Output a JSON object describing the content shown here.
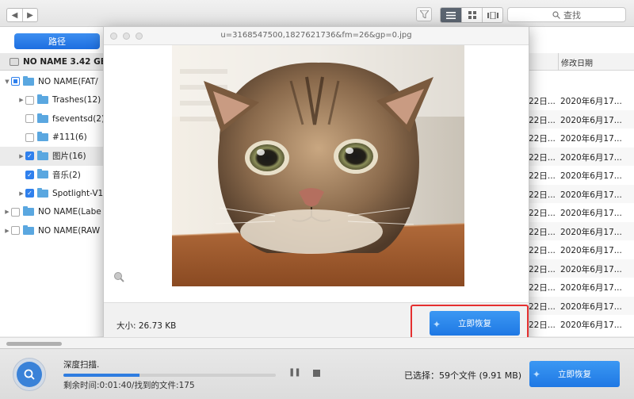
{
  "toolbar": {
    "back_icon": "chevron-left-icon",
    "forward_icon": "chevron-right-icon",
    "search_placeholder": "查找"
  },
  "left_panel": {
    "path_tab": "路径",
    "volume": "NO NAME 3.42 GB",
    "tree": [
      {
        "label": "NO NAME(FAT/",
        "state": "mixed",
        "expanded": true
      },
      {
        "label": "Trashes(12)",
        "state": "unchecked",
        "expanded": false
      },
      {
        "label": "fseventsd(2)",
        "state": "unchecked",
        "expanded": null
      },
      {
        "label": "#111(6)",
        "state": "unchecked",
        "expanded": null
      },
      {
        "label": "图片(16)",
        "state": "checked",
        "expanded": false
      },
      {
        "label": "音乐(2)",
        "state": "checked",
        "expanded": null
      },
      {
        "label": "Spotlight-V1",
        "state": "checked",
        "expanded": false
      },
      {
        "label": "NO NAME(Labe",
        "state": "unchecked",
        "expanded": false
      },
      {
        "label": "NO NAME(RAW",
        "state": "unchecked",
        "expanded": false
      }
    ]
  },
  "list": {
    "column_modified": "修改日期",
    "rows": [
      {
        "created": "22日...",
        "modified": "2020年6月17..."
      },
      {
        "created": "22日...",
        "modified": "2020年6月17..."
      },
      {
        "created": "22日...",
        "modified": "2020年6月17..."
      },
      {
        "created": "22日...",
        "modified": "2020年6月17..."
      },
      {
        "created": "22日...",
        "modified": "2020年6月17..."
      },
      {
        "created": "22日...",
        "modified": "2020年6月17..."
      },
      {
        "created": "22日...",
        "modified": "2020年6月17..."
      },
      {
        "created": "22日...",
        "modified": "2020年6月17..."
      },
      {
        "created": "22日...",
        "modified": "2020年6月17..."
      },
      {
        "created": "22日...",
        "modified": "2020年6月17..."
      },
      {
        "created": "22日...",
        "modified": "2020年6月17..."
      },
      {
        "created": "22日...",
        "modified": "2020年6月17..."
      },
      {
        "created": "22日...",
        "modified": "2020年6月17..."
      }
    ]
  },
  "preview": {
    "title": "u=3168547500,1827621736&fm=26&gp=0.jpg",
    "size_label": "大小: 26.73 KB",
    "recover_button": "立即恢复",
    "highlight_color": "#e53030"
  },
  "bottom": {
    "scan_label": "深度扫描.",
    "remaining": "剩余时间:0:01:40/找到的文件:175",
    "progress": 0.36,
    "selected": "已选择：59个文件 (9.91 MB)",
    "recover_button": "立即恢复"
  },
  "colors": {
    "accent": "#2f80ed"
  }
}
